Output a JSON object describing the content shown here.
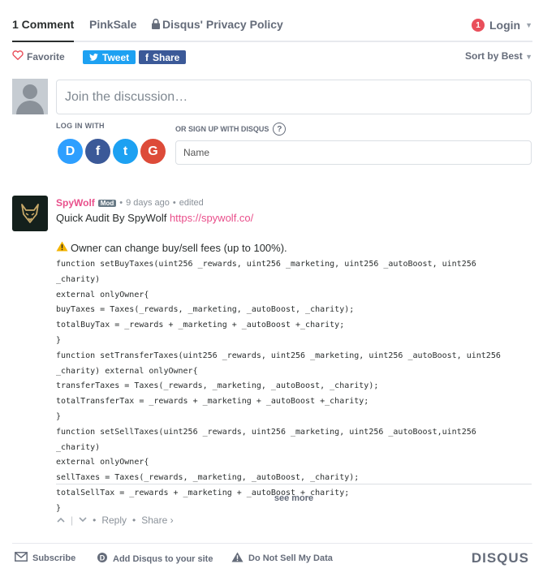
{
  "tabs": {
    "comments": "1 Comment",
    "site": "PinkSale",
    "privacy": "Disqus' Privacy Policy"
  },
  "login": {
    "badge": "1",
    "label": "Login"
  },
  "toolbar": {
    "favorite": "Favorite",
    "tweet": "Tweet",
    "share": "Share",
    "sort": "Sort by Best"
  },
  "compose": {
    "placeholder": "Join the discussion…",
    "login_with": "LOG IN WITH",
    "signup": "OR SIGN UP WITH DISQUS",
    "name_placeholder": "Name",
    "socials": [
      "D",
      "f",
      "t",
      "G"
    ]
  },
  "post": {
    "author": "SpyWolf",
    "badge": "Mod",
    "time": "9 days ago",
    "edited": "edited",
    "intro": "Quick Audit By SpyWolf ",
    "link": "https://spywolf.co/",
    "warning": "Owner can change buy/sell fees (up to 100%).",
    "code": [
      "function setBuyTaxes(uint256 _rewards, uint256 _marketing, uint256 _autoBoost, uint256 _charity)",
      "external onlyOwner{",
      "buyTaxes = Taxes(_rewards, _marketing, _autoBoost, _charity);",
      "totalBuyTax = _rewards + _marketing + _autoBoost +_charity;",
      "}",
      "function setTransferTaxes(uint256 _rewards, uint256 _marketing, uint256 _autoBoost, uint256",
      "_charity) external onlyOwner{",
      "transferTaxes = Taxes(_rewards, _marketing, _autoBoost, _charity);",
      "totalTransferTax = _rewards + _marketing + _autoBoost +_charity;",
      "}",
      "function setSellTaxes(uint256 _rewards, uint256 _marketing, uint256 _autoBoost,uint256 _charity)",
      "external onlyOwner{",
      "sellTaxes = Taxes(_rewards, _marketing, _autoBoost, _charity);",
      "totalSellTax = _rewards + _marketing + _autoBoost +_charity;",
      "}"
    ],
    "see_more": "see more",
    "reply": "Reply",
    "share": "Share ›"
  },
  "footer": {
    "subscribe": "Subscribe",
    "add_disqus": "Add Disqus to your site",
    "do_not_sell": "Do Not Sell My Data",
    "logo": "DISQUS"
  }
}
